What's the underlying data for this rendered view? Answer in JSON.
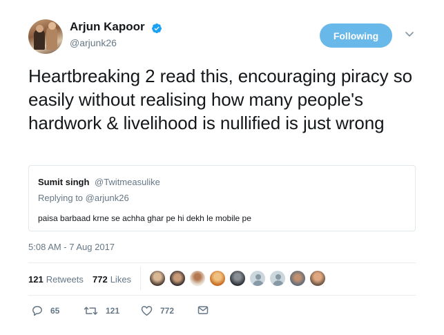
{
  "author": {
    "name": "Arjun Kapoor",
    "handle": "@arjunk26",
    "verified": true,
    "avatar": "avatar-photo"
  },
  "follow_button": {
    "label": "Following"
  },
  "menu": {
    "icon": "chevron-down-icon"
  },
  "tweet": {
    "text": "Heartbreaking 2 read this, encouraging piracy so easily without realising how many people's hardwork & livelihood is nullified is just wrong",
    "timestamp": "5:08 AM - 7 Aug 2017"
  },
  "quoted_tweet": {
    "name": "Sumit singh",
    "handle": "@Twitmeasulike",
    "replying_prefix": "Replying to ",
    "replying_to": "@arjunk26",
    "text": "paisa barbaad krne se achha ghar pe hi dekh le mobile pe"
  },
  "stats": {
    "retweets_count": "121",
    "retweets_label": "Retweets",
    "likes_count": "772",
    "likes_label": "Likes"
  },
  "actions": {
    "reply_count": "65",
    "retweet_count": "121",
    "like_count": "772"
  },
  "colors": {
    "accent": "#1da1f2",
    "follow_button": "#69b8ea",
    "secondary_text": "#657786",
    "primary_text": "#14171a"
  }
}
